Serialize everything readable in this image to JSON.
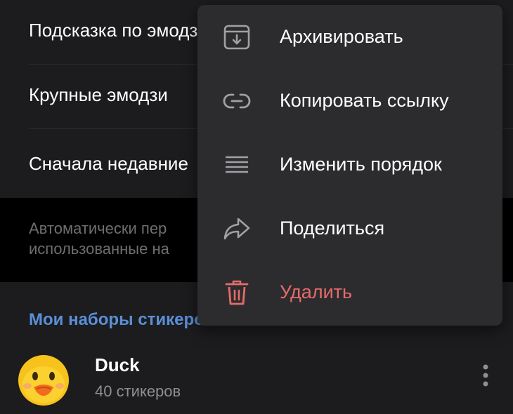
{
  "settings": {
    "rows": [
      {
        "label": "Подсказка по эмодзи"
      },
      {
        "label": "Крупные эмодзи"
      },
      {
        "label": "Сначала недавние"
      }
    ],
    "hint": "Автоматически пер\nиспользованные на"
  },
  "section": {
    "title": "Мои наборы стикеров"
  },
  "pack": {
    "name": "Duck",
    "count": "40 стикеров",
    "icon": "duck-emoji"
  },
  "menu": {
    "items": [
      {
        "label": "Архивировать",
        "icon": "archive-icon"
      },
      {
        "label": "Копировать ссылку",
        "icon": "link-icon"
      },
      {
        "label": "Изменить порядок",
        "icon": "reorder-icon"
      },
      {
        "label": "Поделиться",
        "icon": "share-icon"
      },
      {
        "label": "Удалить",
        "icon": "trash-icon"
      }
    ]
  },
  "colors": {
    "background": "#1c1c1e",
    "menu_background": "#2c2c2e",
    "accent": "#5b8fd6",
    "danger": "#e66b6b",
    "muted_text": "#6e6e72"
  }
}
